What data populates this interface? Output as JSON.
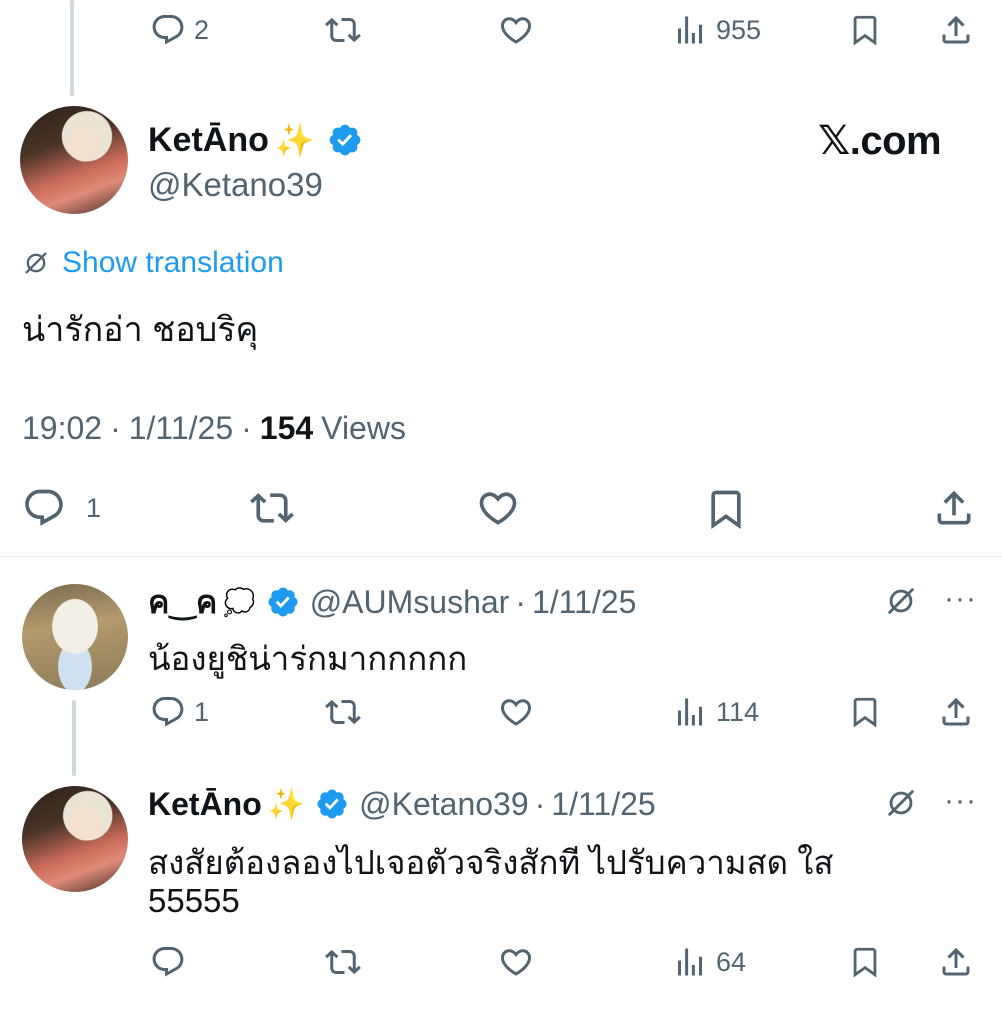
{
  "top_actions": {
    "replies": "2",
    "views": "955"
  },
  "main_tweet": {
    "display_name": "KetĀno",
    "name_emoji": "✨",
    "handle": "@Ketano39",
    "watermark": "𝕏.com",
    "translate_label": "Show translation",
    "text": "น่ารักอ่า ชอบริคุ",
    "time": "19:02",
    "date": "1/11/25",
    "views_count": "154",
    "views_label": "Views",
    "separator": "·",
    "replies": "1"
  },
  "reply1": {
    "display_name": "ค‿ค",
    "name_emoji": "💭",
    "handle": "@AUMsushar",
    "date": "1/11/25",
    "text": "น้องยูชิน่าร่กมากกกกก",
    "replies": "1",
    "views": "114"
  },
  "reply2": {
    "display_name": "KetĀno",
    "name_emoji": "✨",
    "handle": "@Ketano39",
    "date": "1/11/25",
    "text_line1": "สงสัยต้องลองไปเจอตัวจริงสักที ไปรับความสด ใส",
    "text_line2": "55555",
    "views": "64"
  },
  "colors": {
    "text": "#0f1419",
    "muted": "#536471",
    "link": "#1d9bf0",
    "verified": "#1d9bf0",
    "divider": "#eff3f4",
    "thread_line": "#cfd9de"
  }
}
